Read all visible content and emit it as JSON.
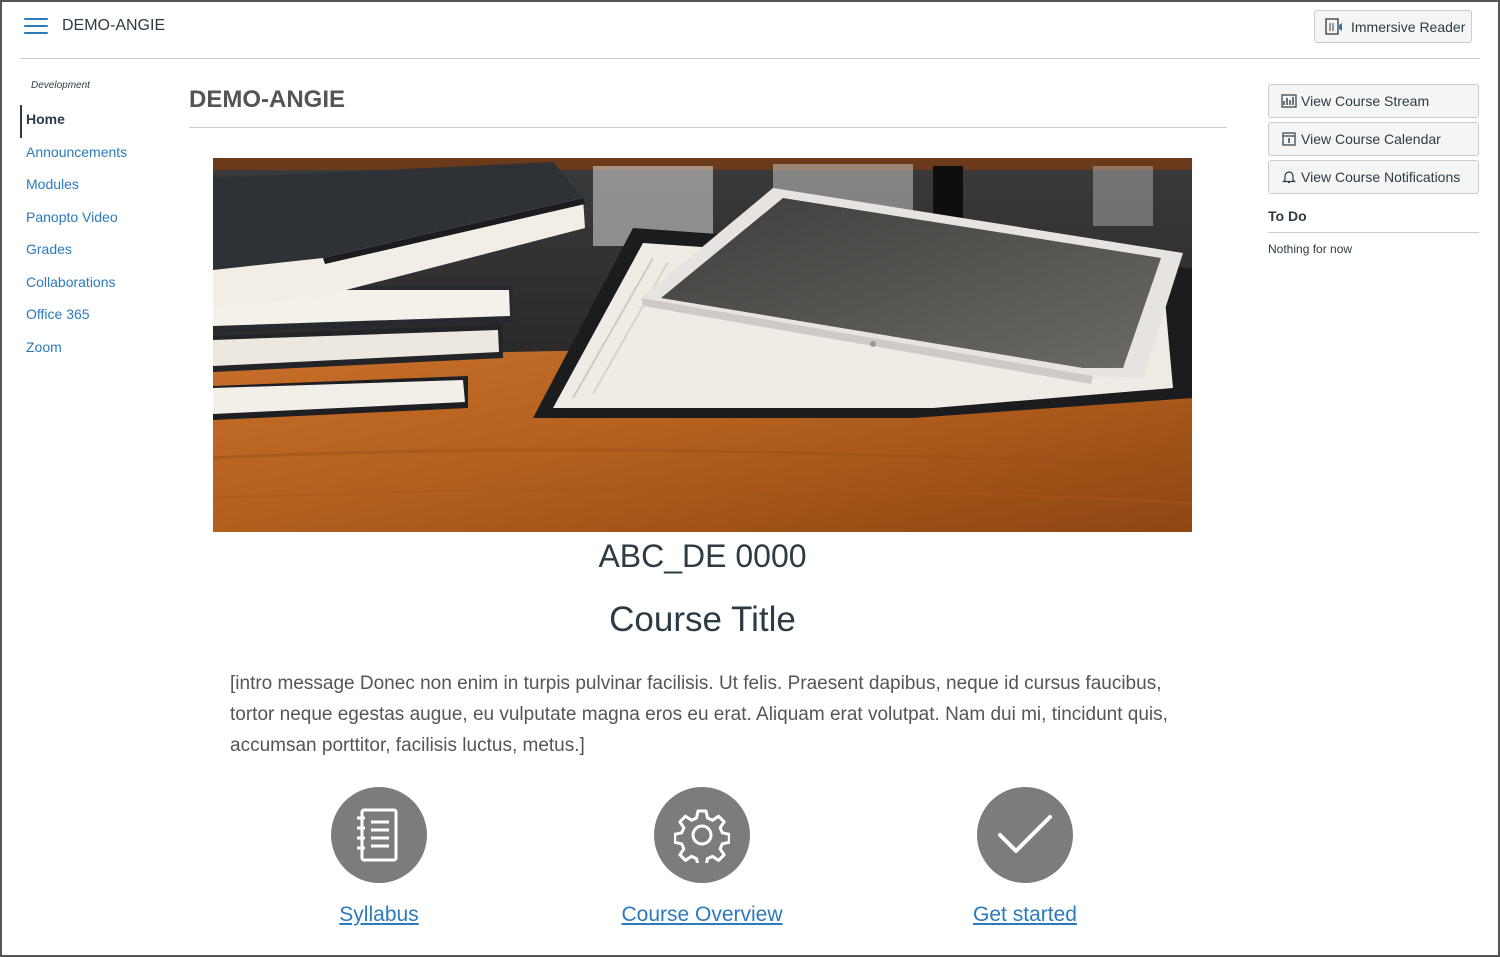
{
  "header": {
    "breadcrumb": "DEMO-ANGIE",
    "immersive_reader_label": "Immersive Reader"
  },
  "nav": {
    "subtitle": "Development",
    "items": [
      {
        "label": "Home"
      },
      {
        "label": "Announcements"
      },
      {
        "label": "Modules"
      },
      {
        "label": "Panopto Video"
      },
      {
        "label": "Grades"
      },
      {
        "label": "Collaborations"
      },
      {
        "label": "Office 365"
      },
      {
        "label": "Zoom"
      }
    ]
  },
  "main": {
    "title": "DEMO-ANGIE",
    "course_code": "ABC_DE 0000",
    "course_title": "Course Title",
    "intro": "[intro message Donec non enim in turpis pulvinar facilisis. Ut felis. Praesent dapibus, neque id cursus faucibus, tortor neque egestas augue, eu vulputate magna eros eu erat. Aliquam erat volutpat. Nam dui mi, tincidunt quis, accumsan porttitor, facilisis luctus, metus.]",
    "tiles": [
      {
        "label": "Syllabus",
        "icon": "syllabus-notebook-icon"
      },
      {
        "label": "Course Overview",
        "icon": "gear-icon"
      },
      {
        "label": "Get started",
        "icon": "checkmark-icon"
      }
    ]
  },
  "sidebar": {
    "buttons": [
      {
        "label": "View Course Stream",
        "icon": "stream-chart-icon"
      },
      {
        "label": "View Course Calendar",
        "icon": "calendar-icon"
      },
      {
        "label": "View Course Notifications",
        "icon": "bell-icon"
      }
    ],
    "todo_heading": "To Do",
    "todo_empty": "Nothing for now"
  },
  "colors": {
    "link": "#2b7abc",
    "text": "#2d3b45",
    "icon_circle": "#7c7c7c",
    "divider": "#c7cdd1"
  }
}
